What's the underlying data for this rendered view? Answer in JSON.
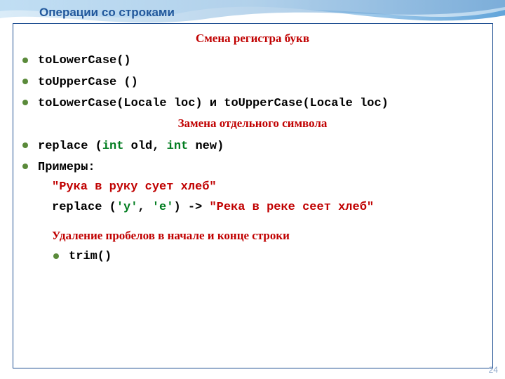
{
  "title": "Операции со строками",
  "page_number": "24",
  "section1_heading": "Смена регистра букв",
  "bullets1": [
    "toLowerCase()",
    "toUpperCase ()",
    "toLowerCase(Locale loc) и toUpperCase(Locale loc)"
  ],
  "section2_heading": "Замена отдельного символа",
  "replace_text": {
    "prefix": "replace (",
    "kw": "int",
    "mid1": " old, ",
    "mid2": " new)"
  },
  "examples_label": "Примеры:",
  "ex_str1": "\"Рука в руку сует хлеб\"",
  "ex_line2": {
    "prefix": "replace (",
    "arg1": "'у'",
    "comma": ", ",
    "arg2": "'е'",
    "arrow": ") -> ",
    "result": "\"Река в реке сеет хлеб\""
  },
  "section3_heading": "Удаление пробелов в начале и конце строки",
  "trim_text": "trim()"
}
